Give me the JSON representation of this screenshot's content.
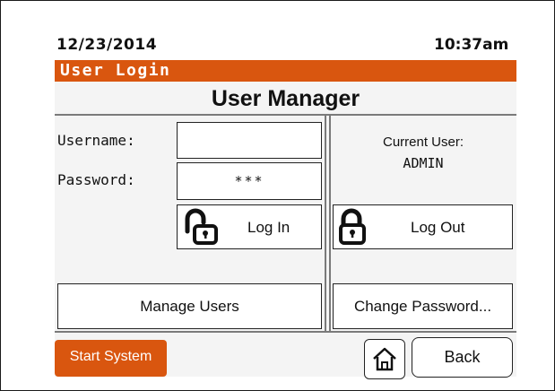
{
  "status": {
    "date": "12/23/2014",
    "time": "10:37am"
  },
  "title_bar": {
    "label": "User Login"
  },
  "heading": "User Manager",
  "login": {
    "username_label": "Username:",
    "username_value": "",
    "password_label": "Password:",
    "password_value": "***",
    "login_button": "Log In",
    "lock_icon": "lock-open-icon"
  },
  "current_user": {
    "label": "Current User:",
    "value": "ADMIN",
    "logout_button": "Log Out",
    "lock_icon": "lock-closed-icon"
  },
  "actions": {
    "manage_users": "Manage Users",
    "change_password": "Change Password..."
  },
  "footer": {
    "start_system": "Start System",
    "home_icon": "home-icon",
    "back": "Back"
  },
  "colors": {
    "accent": "#d9560f",
    "panel_bg": "#f4f4f4",
    "divider": "#7a7a7a"
  }
}
